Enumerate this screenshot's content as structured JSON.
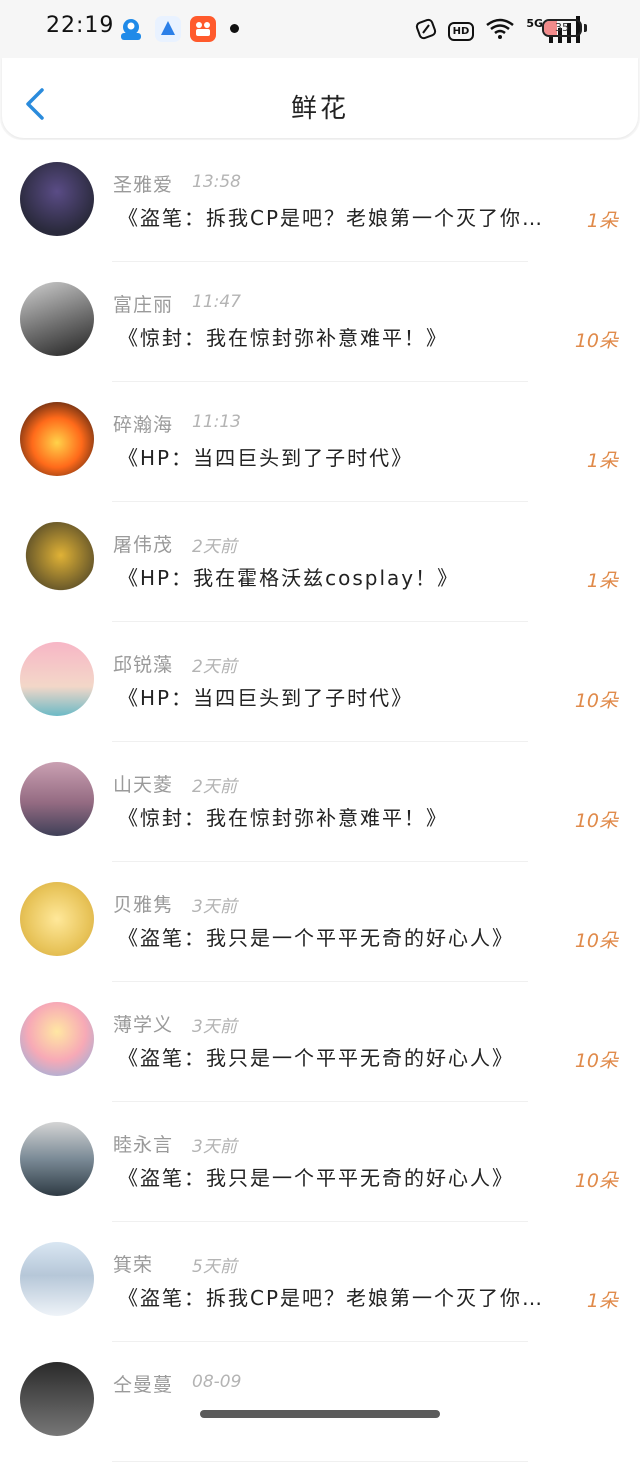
{
  "status_bar": {
    "time": "22:19",
    "network": "5G",
    "hd": "HD",
    "battery_text": "35",
    "battery_level": 0.35,
    "icons": [
      "app-qq-icon",
      "app-blue-icon",
      "app-orange-icon",
      "dot-icon",
      "nfc-icon",
      "hd-icon",
      "wifi-icon",
      "signal-icon",
      "battery-icon"
    ]
  },
  "header": {
    "title": "鲜花",
    "back_icon": "chevron-left-icon"
  },
  "colors": {
    "accent": "#2a8bdc",
    "count_orange": "#e08a4a",
    "name_gray": "#9a9a9a",
    "time_gray": "#b4b4b4"
  },
  "list": [
    {
      "name": "圣雅爱",
      "time": "13:58",
      "message": "《盗笔：拆我CP是吧？老娘第一个灭了你…",
      "count": "1朵"
    },
    {
      "name": "富庄丽",
      "time": "11:47",
      "message": "《惊封：我在惊封弥补意难平！》",
      "count": "10朵"
    },
    {
      "name": "碎瀚海",
      "time": "11:13",
      "message": "《HP：当四巨头到了子时代》",
      "count": "1朵"
    },
    {
      "name": "屠伟茂",
      "time": "2天前",
      "message": "《HP：我在霍格沃兹cosplay！》",
      "count": "1朵"
    },
    {
      "name": "邱锐藻",
      "time": "2天前",
      "message": "《HP：当四巨头到了子时代》",
      "count": "10朵"
    },
    {
      "name": "山天菱",
      "time": "2天前",
      "message": "《惊封：我在惊封弥补意难平！》",
      "count": "10朵"
    },
    {
      "name": "贝雅隽",
      "time": "3天前",
      "message": "《盗笔：我只是一个平平无奇的好心人》",
      "count": "10朵"
    },
    {
      "name": "薄学义",
      "time": "3天前",
      "message": "《盗笔：我只是一个平平无奇的好心人》",
      "count": "10朵"
    },
    {
      "name": "睦永言",
      "time": "3天前",
      "message": "《盗笔：我只是一个平平无奇的好心人》",
      "count": "10朵"
    },
    {
      "name": "箕荣",
      "time": "5天前",
      "message": "《盗笔：拆我CP是吧？老娘第一个灭了你…",
      "count": "1朵"
    },
    {
      "name": "仝曼蔓",
      "time": "08-09",
      "message": "",
      "count": ""
    }
  ]
}
